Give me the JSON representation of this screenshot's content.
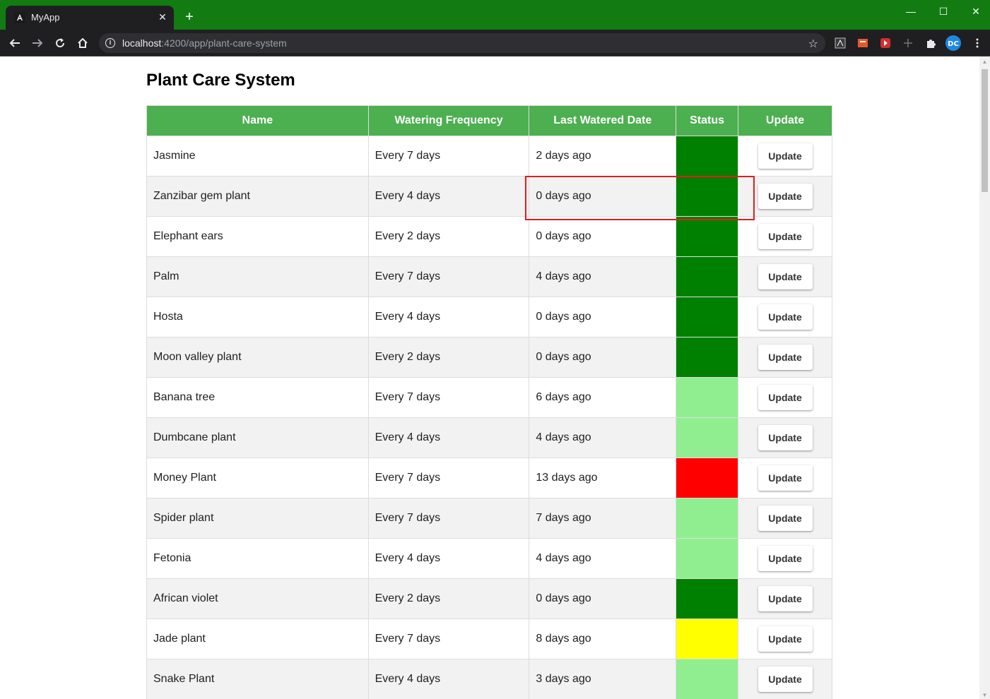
{
  "browser": {
    "tab_title": "MyApp",
    "tab_close": "✕",
    "new_tab": "+",
    "url_host": "localhost",
    "url_rest": ":4200/app/plant-care-system",
    "window_controls": {
      "minimize": "—",
      "maximize": "☐",
      "close": "✕"
    }
  },
  "page": {
    "title": "Plant Care System"
  },
  "table": {
    "headers": [
      "Name",
      "Watering Frequency",
      "Last Watered Date",
      "Status",
      "Update"
    ],
    "rows": [
      {
        "name": "Jasmine",
        "frequency": "Every 7 days",
        "last_watered": "2 days ago",
        "status_color": "#008000",
        "update_label": "Update"
      },
      {
        "name": "Zanzibar gem plant",
        "frequency": "Every 4 days",
        "last_watered": "0 days ago",
        "status_color": "#008000",
        "update_label": "Update"
      },
      {
        "name": "Elephant ears",
        "frequency": "Every 2 days",
        "last_watered": "0 days ago",
        "status_color": "#008000",
        "update_label": "Update"
      },
      {
        "name": "Palm",
        "frequency": "Every 7 days",
        "last_watered": "4 days ago",
        "status_color": "#008000",
        "update_label": "Update"
      },
      {
        "name": "Hosta",
        "frequency": "Every 4 days",
        "last_watered": "0 days ago",
        "status_color": "#008000",
        "update_label": "Update"
      },
      {
        "name": "Moon valley plant",
        "frequency": "Every 2 days",
        "last_watered": "0 days ago",
        "status_color": "#008000",
        "update_label": "Update"
      },
      {
        "name": "Banana tree",
        "frequency": "Every 7 days",
        "last_watered": "6 days ago",
        "status_color": "#90ee90",
        "update_label": "Update"
      },
      {
        "name": "Dumbcane plant",
        "frequency": "Every 4 days",
        "last_watered": "4 days ago",
        "status_color": "#90ee90",
        "update_label": "Update"
      },
      {
        "name": "Money Plant",
        "frequency": "Every 7 days",
        "last_watered": "13 days ago",
        "status_color": "#ff0000",
        "update_label": "Update"
      },
      {
        "name": "Spider plant",
        "frequency": "Every 7 days",
        "last_watered": "7 days ago",
        "status_color": "#90ee90",
        "update_label": "Update"
      },
      {
        "name": "Fetonia",
        "frequency": "Every 4 days",
        "last_watered": "4 days ago",
        "status_color": "#90ee90",
        "update_label": "Update"
      },
      {
        "name": "African violet",
        "frequency": "Every 2 days",
        "last_watered": "0 days ago",
        "status_color": "#008000",
        "update_label": "Update"
      },
      {
        "name": "Jade plant",
        "frequency": "Every 7 days",
        "last_watered": "8 days ago",
        "status_color": "#ffff00",
        "update_label": "Update"
      },
      {
        "name": "Snake Plant",
        "frequency": "Every 4 days",
        "last_watered": "3 days ago",
        "status_color": "#90ee90",
        "update_label": "Update"
      }
    ]
  },
  "colors": {
    "header_bg": "#4caf50",
    "titlebar_bg": "#127c12",
    "highlight": "#e51c1c"
  }
}
